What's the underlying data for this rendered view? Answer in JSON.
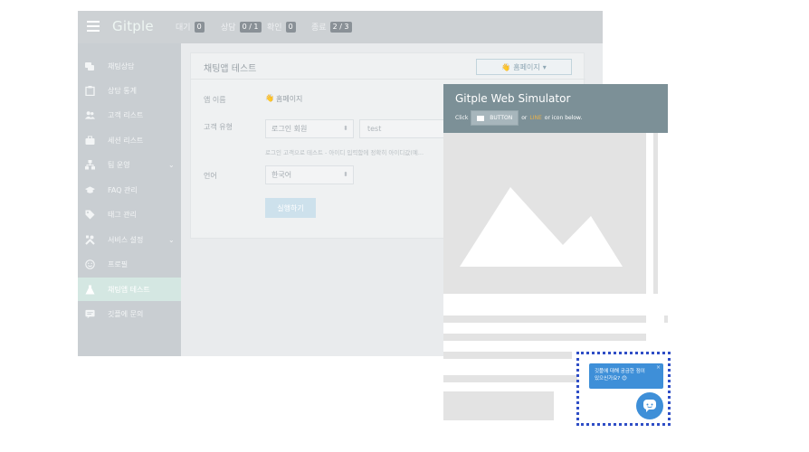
{
  "admin": {
    "logo": "Gitple",
    "stats": [
      {
        "label": "대기",
        "value": "0"
      },
      {
        "label": "상담",
        "value": "0 / 1"
      },
      {
        "label": "확인",
        "value": "0"
      },
      {
        "label": "종료",
        "value": "2 / 3"
      }
    ],
    "sidebar": [
      {
        "label": "채팅상담",
        "icon": "chat-bubbles-icon"
      },
      {
        "label": "상담 통계",
        "icon": "clipboard-icon"
      },
      {
        "label": "고객 리스트",
        "icon": "users-icon"
      },
      {
        "label": "세션 리스트",
        "icon": "briefcase-icon"
      },
      {
        "label": "팀 운영",
        "icon": "sitemap-icon",
        "chevron": "⌄"
      },
      {
        "label": "FAQ 관리",
        "icon": "graduation-cap-icon"
      },
      {
        "label": "태그 관리",
        "icon": "tag-icon"
      },
      {
        "label": "서비스 설정",
        "icon": "tools-icon",
        "chevron": "⌄"
      },
      {
        "label": "프로필",
        "icon": "smile-icon"
      },
      {
        "label": "채팅앱 테스트",
        "icon": "flask-icon",
        "active": true
      },
      {
        "label": "깃플에 문의",
        "icon": "message-icon"
      }
    ],
    "card": {
      "title": "채팅앱 테스트",
      "home_select": "홈페이지",
      "app_name_label": "앱 이름",
      "app_name_value": "홈페이지",
      "customer_type_label": "고객 유형",
      "customer_type_value": "로그인 회원",
      "customer_id_value": "test",
      "hint": "로그인 고객으로 테스트 - 아이디 입력함에 정확히 아이디값(예...",
      "language_label": "언어",
      "language_value": "한국어",
      "run_button": "실행하기"
    }
  },
  "simulator": {
    "title": "Gitple Web Simulator",
    "sub_click": "Click",
    "sub_button": "BUTTON",
    "sub_or1": "or",
    "sub_line": "LINE",
    "sub_rest": "or icon below.",
    "bubble_line1": "깃플에 대해 궁금한 점이",
    "bubble_line2": "있으신가요? 😊",
    "bubble_close": "×"
  },
  "colors": {
    "chat_blue": "#3e8fd8",
    "dotted_frame": "#2f4ec6",
    "sim_header": "#7c9097",
    "line_accent": "#e8b04a"
  }
}
